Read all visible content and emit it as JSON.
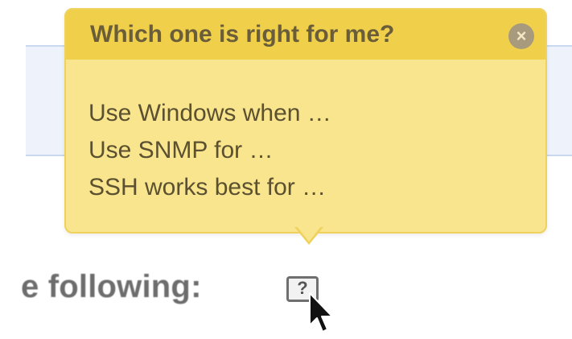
{
  "tooltip": {
    "title": "Which one is right for me?",
    "close_icon": "close-icon",
    "lines": [
      "Use Windows when …",
      "Use SNMP for …",
      "SSH works best for …"
    ]
  },
  "page": {
    "text": "e following:",
    "help_icon_label": "?",
    "help_icon": "help-icon"
  },
  "colors": {
    "tooltip_background": "#f8e58d",
    "tooltip_header": "#f0cf4a",
    "tooltip_border": "#efd15e",
    "page_text": "#6d6d6d"
  }
}
